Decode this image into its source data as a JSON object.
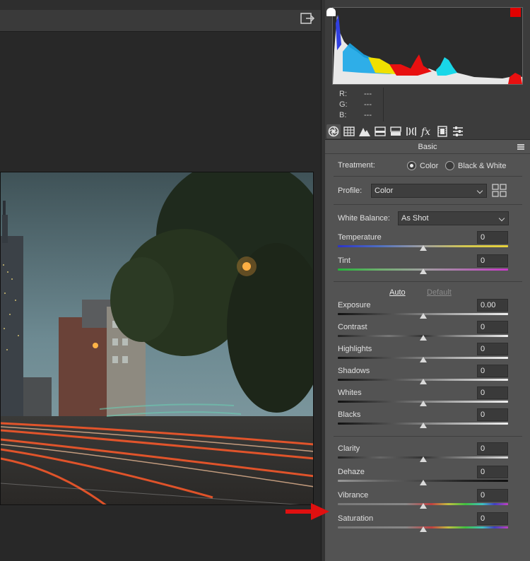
{
  "rgb_readout": [
    {
      "label": "R:",
      "value": "---"
    },
    {
      "label": "G:",
      "value": "---"
    },
    {
      "label": "B:",
      "value": "---"
    }
  ],
  "tabs": [
    "basic-icon",
    "tone-curve-icon",
    "detail-icon",
    "hsl-icon",
    "split-toning-icon",
    "lens-corrections-icon",
    "effects-icon",
    "camera-calibration-icon",
    "presets-icon"
  ],
  "panel": {
    "section_title": "Basic",
    "treatment_label": "Treatment:",
    "treatment_color": "Color",
    "treatment_bw": "Black & White",
    "profile_label": "Profile:",
    "profile_value": "Color",
    "wb_label": "White Balance:",
    "wb_value": "As Shot",
    "auto": "Auto",
    "default": "Default"
  },
  "sliders": [
    {
      "label": "Temperature",
      "value": "0",
      "level": 0.5
    },
    {
      "label": "Tint",
      "value": "0",
      "level": 0.5
    },
    {
      "label": "Exposure",
      "value": "0.00",
      "level": 0.5
    },
    {
      "label": "Contrast",
      "value": "0",
      "level": 0.5
    },
    {
      "label": "Highlights",
      "value": "0",
      "level": 0.5
    },
    {
      "label": "Shadows",
      "value": "0",
      "level": 0.5
    },
    {
      "label": "Whites",
      "value": "0",
      "level": 0.5
    },
    {
      "label": "Blacks",
      "value": "0",
      "level": 0.5
    },
    {
      "label": "Clarity",
      "value": "0",
      "level": 0.5
    },
    {
      "label": "Dehaze",
      "value": "0",
      "level": 0.5
    },
    {
      "label": "Vibrance",
      "value": "0",
      "level": 0.5
    },
    {
      "label": "Saturation",
      "value": "0",
      "level": 0.5
    }
  ],
  "colors": {
    "annotation_arrow": "#e01010",
    "panel_bg": "#535353",
    "highlight_clip": "#e10000"
  }
}
